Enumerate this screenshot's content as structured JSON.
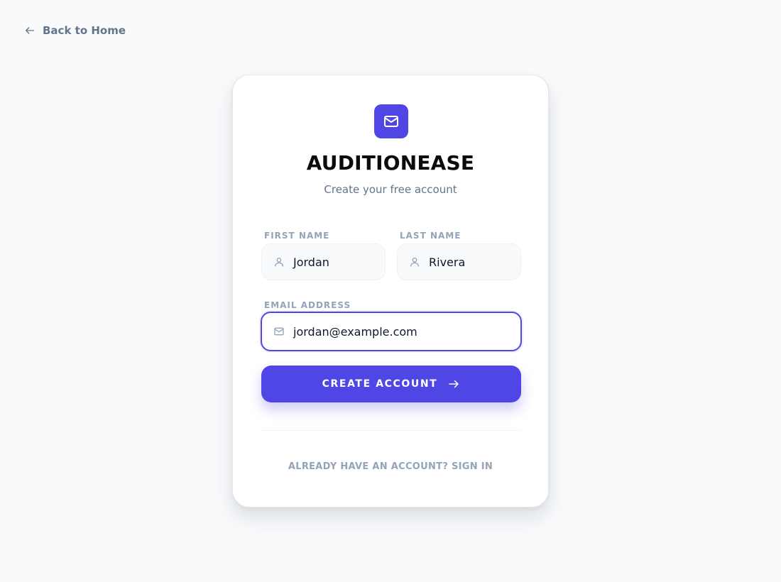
{
  "nav": {
    "back_label": "Back to Home"
  },
  "brand": {
    "name": "AUDITIONEASE",
    "logo_icon": "mail-icon",
    "tagline": "Create your free account"
  },
  "form": {
    "first_name": {
      "label": "FIRST NAME",
      "value": "Jordan",
      "icon": "user-icon"
    },
    "last_name": {
      "label": "LAST NAME",
      "value": "Rivera",
      "icon": "user-icon"
    },
    "email": {
      "label": "EMAIL ADDRESS",
      "value": "jordan@example.com",
      "icon": "mail-icon"
    },
    "submit_label": "CREATE ACCOUNT",
    "submit_icon": "arrow-right-icon"
  },
  "footer": {
    "signin_label": "ALREADY HAVE AN ACCOUNT? SIGN IN"
  },
  "colors": {
    "accent": "#4f46e5",
    "background": "#f8fafc",
    "muted_text": "#64748b",
    "label_text": "#94a3b8"
  }
}
